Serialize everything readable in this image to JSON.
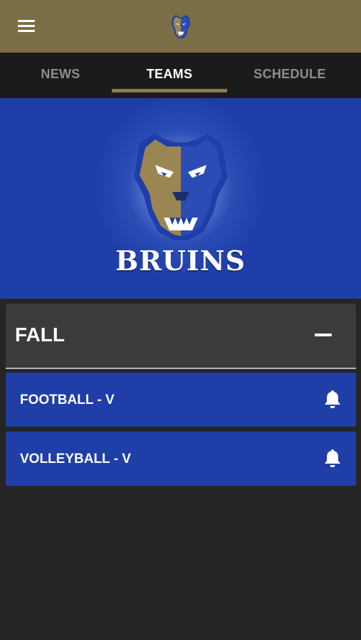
{
  "header": {
    "menu_icon": "hamburger-menu-icon",
    "logo_icon": "bruins-bear-logo"
  },
  "tabs": [
    {
      "label": "NEWS",
      "active": false
    },
    {
      "label": "TEAMS",
      "active": true
    },
    {
      "label": "SCHEDULE",
      "active": false
    }
  ],
  "hero": {
    "title": "BRUINS",
    "logo_icon": "bruins-bear-logo"
  },
  "season": {
    "label": "FALL",
    "expanded": true,
    "toggle_icon": "minus-icon"
  },
  "teams": [
    {
      "name": "FOOTBALL - V",
      "icon": "bell-icon"
    },
    {
      "name": "VOLLEYBALL - V",
      "icon": "bell-icon"
    }
  ],
  "colors": {
    "gold": "#7b6d45",
    "tab_underline": "#8a7b51",
    "royal_blue": "#1f3ea8",
    "dark_background": "#252525",
    "tab_bar": "#1b1b1b",
    "section_header": "#3b3b3b"
  }
}
